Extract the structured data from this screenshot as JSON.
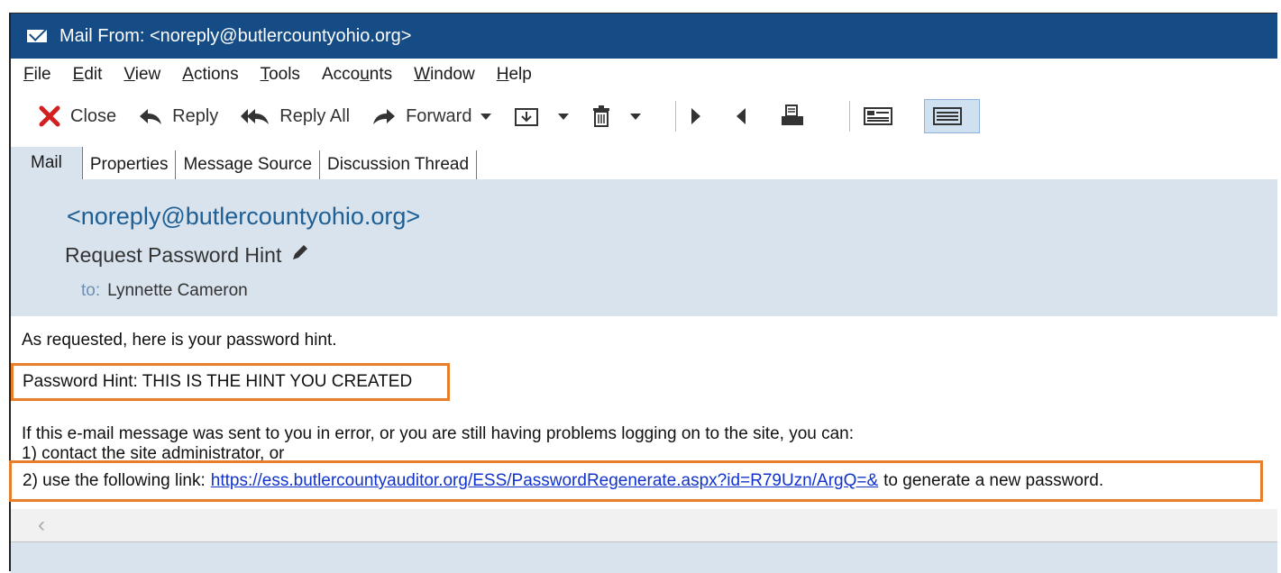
{
  "window": {
    "title": "Mail From: <noreply@butlercountyohio.org>"
  },
  "menu": [
    {
      "label": "File",
      "mnemonic": "F",
      "rest": "ile"
    },
    {
      "label": "Edit",
      "mnemonic": "E",
      "rest": "dit"
    },
    {
      "label": "View",
      "mnemonic": "V",
      "rest": "iew"
    },
    {
      "label": "Actions",
      "mnemonic": "A",
      "rest": "ctions"
    },
    {
      "label": "Tools",
      "mnemonic": "T",
      "rest": "ools"
    },
    {
      "label": "Accounts",
      "mnemonic_pre": "Acco",
      "mnemonic": "u",
      "rest": "nts"
    },
    {
      "label": "Window",
      "mnemonic": "W",
      "rest": "indow"
    },
    {
      "label": "Help",
      "mnemonic": "H",
      "rest": "elp"
    }
  ],
  "toolbar": {
    "close": "Close",
    "reply": "Reply",
    "reply_all": "Reply All",
    "forward": "Forward"
  },
  "tabs": [
    "Mail",
    "Properties",
    "Message Source",
    "Discussion Thread"
  ],
  "header": {
    "from": "<noreply@butlercountyohio.org>",
    "subject": "Request Password Hint",
    "to_label": "to:",
    "to_value": "Lynnette Cameron"
  },
  "body": {
    "line1": "As requested, here is your password hint.",
    "hint": "Password Hint: THIS IS THE HINT YOU CREATED",
    "line3": "If this e-mail message was sent to you in error, or you are still having problems logging on to the site, you can:",
    "line4": "1) contact the site administrator, or",
    "line5_pre": "2) use the following link:",
    "link": "https://ess.butlercountyauditor.org/ESS/PasswordRegenerate.aspx?id=R79Uzn/ArgQ=&",
    "line5_post": "to generate a new password."
  },
  "colors": {
    "titlebar": "#154c85",
    "header_bg": "#d8e3ee",
    "highlight": "#e87d2a",
    "link": "#1133cc"
  }
}
